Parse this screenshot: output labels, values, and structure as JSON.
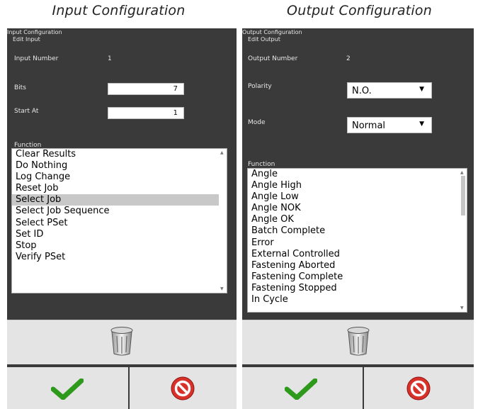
{
  "captions": {
    "left": "Input Configuration",
    "right": "Output Configuration"
  },
  "input": {
    "window_title": "Input Configuration",
    "section_title": "Edit Input",
    "number_label": "Input Number",
    "number_value": "1",
    "bits_label": "Bits",
    "bits_value": "7",
    "start_label": "Start At",
    "start_value": "1",
    "function_label": "Function",
    "functions": [
      "Clear Results",
      "Do Nothing",
      "Log Change",
      "Reset Job",
      "Select Job",
      "Select Job Sequence",
      "Select PSet",
      "Set ID",
      "Stop",
      "Verify PSet"
    ],
    "selected_function": "Select Job"
  },
  "output": {
    "window_title": "Output Configuration",
    "section_title": "Edit Output",
    "number_label": "Output Number",
    "number_value": "2",
    "polarity_label": "Polarity",
    "polarity_value": "N.O.",
    "mode_label": "Mode",
    "mode_value": "Normal",
    "function_label": "Function",
    "functions": [
      "Angle",
      "Angle High",
      "Angle Low",
      "Angle NOK",
      "Angle OK",
      "Batch Complete",
      "Error",
      "External Controlled",
      "Fastening Aborted",
      "Fastening Complete",
      "Fastening Stopped",
      "In Cycle"
    ]
  },
  "icons": {
    "delete": "trash-icon",
    "confirm": "checkmark-icon",
    "cancel": "cancel-icon",
    "dropdown": "dropdown-arrow-icon"
  },
  "colors": {
    "panel_bg": "#3a3a3a",
    "button_bg": "#e4e4e4",
    "confirm_green": "#2e9a1c",
    "cancel_red": "#d8312a",
    "selection": "#c8c8c8"
  }
}
